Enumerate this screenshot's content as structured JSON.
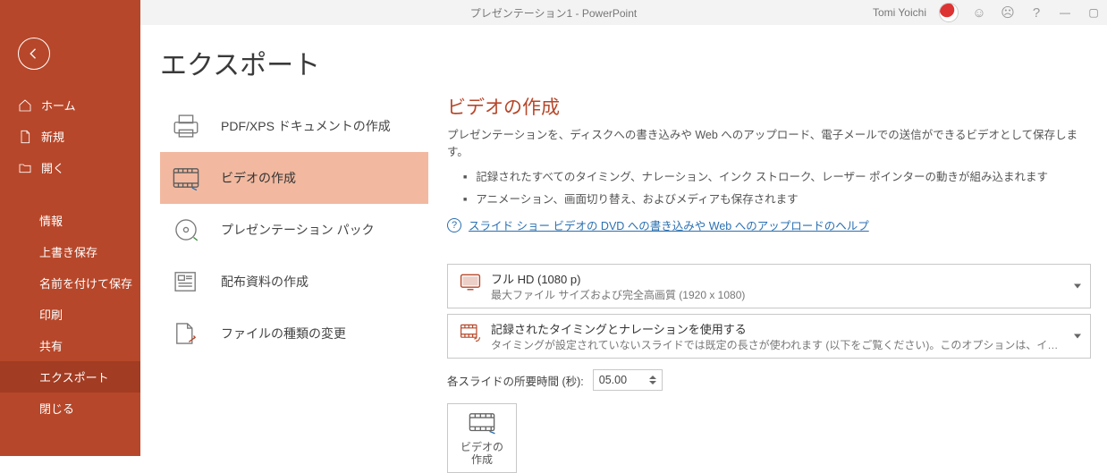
{
  "title": "プレゼンテーション1  -  PowerPoint",
  "user": "Tomi Yoichi",
  "sidebar": {
    "home": "ホーム",
    "new": "新規",
    "open": "開く",
    "info": "情報",
    "save": "上書き保存",
    "saveas": "名前を付けて保存",
    "print": "印刷",
    "share": "共有",
    "export": "エクスポート",
    "close": "閉じる"
  },
  "page_heading": "エクスポート",
  "export_items": {
    "pdf": "PDF/XPS ドキュメントの作成",
    "video": "ビデオの作成",
    "package": "プレゼンテーション パック",
    "handout": "配布資料の作成",
    "filetype": "ファイルの種類の変更"
  },
  "pane": {
    "title": "ビデオの作成",
    "desc": "プレゼンテーションを、ディスクへの書き込みや Web へのアップロード、電子メールでの送信ができるビデオとして保存します。",
    "bullet1": "記録されたすべてのタイミング、ナレーション、インク ストローク、レーザー ポインターの動きが組み込まれます",
    "bullet2": "アニメーション、画面切り替え、およびメディアも保存されます",
    "help": "スライド ショー ビデオの DVD への書き込みや Web へのアップロードのヘルプ",
    "quality_title": "フル HD (1080 p)",
    "quality_sub": "最大ファイル サイズおよび完全高画質 (1920 x 1080)",
    "timing_title": "記録されたタイミングとナレーションを使用する",
    "timing_sub": "タイミングが設定されていないスライドでは既定の長さが使われます (以下をご覧ください)。このオプションは、インクとレーザー…",
    "seconds_label": "各スライドの所要時間 (秒):",
    "seconds_value": "05.00",
    "create_label1": "ビデオの",
    "create_label2": "作成"
  }
}
